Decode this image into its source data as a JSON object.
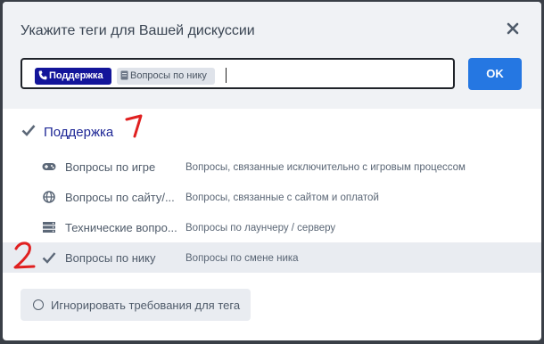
{
  "dialog": {
    "title": "Укажите теги для Вашей дискуссии",
    "close_icon": "close-icon",
    "ok_label": "OK"
  },
  "selected_tags": [
    {
      "label": "Поддержка",
      "icon": "phone-icon",
      "color": "#13159a"
    },
    {
      "label": "Вопросы по нику",
      "icon": "document-icon",
      "color": "#dfe3ea"
    }
  ],
  "group": {
    "label": "Поддержка",
    "checked": true
  },
  "items": [
    {
      "name": "Вопросы по игре",
      "description": "Вопросы, связанные исключительно с игровым процессом",
      "icon": "gamepad-icon",
      "checked": false
    },
    {
      "name": "Вопросы по сайту/...",
      "description": "Вопросы, связанные с сайтом и оплатой",
      "icon": "globe-icon",
      "checked": false
    },
    {
      "name": "Технические вопро...",
      "description": "Вопросы по лаунчеру / серверу",
      "icon": "server-icon",
      "checked": false
    },
    {
      "name": "Вопросы по нику",
      "description": "Вопросы по смене ника",
      "icon": "check-icon",
      "checked": true
    }
  ],
  "ignore_button": {
    "label": "Игнорировать требования для тега"
  },
  "annotations": {
    "mark1": "1",
    "mark2": "2",
    "color": "#e02020"
  },
  "colors": {
    "accent": "#2577e2",
    "tag_primary": "#13159a",
    "group_label": "#1e2796"
  }
}
